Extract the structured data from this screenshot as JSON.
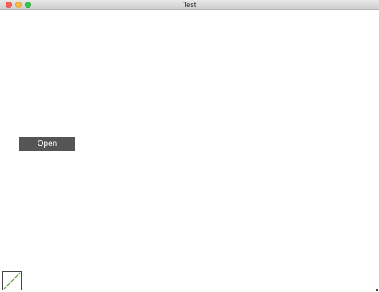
{
  "window": {
    "title": "Test"
  },
  "main": {
    "open_button_label": "Open"
  },
  "icons": {
    "close": "close-traffic-light",
    "minimize": "minimize-traffic-light",
    "zoom": "zoom-traffic-light",
    "thumbnail": "line-chart-thumbnail-icon"
  },
  "colors": {
    "button_bg": "#555555",
    "button_text": "#ffffff",
    "close": "#fc605c",
    "minimize": "#fdbc40",
    "zoom": "#34c84a",
    "thumbnail_line": "#5aa02c"
  }
}
